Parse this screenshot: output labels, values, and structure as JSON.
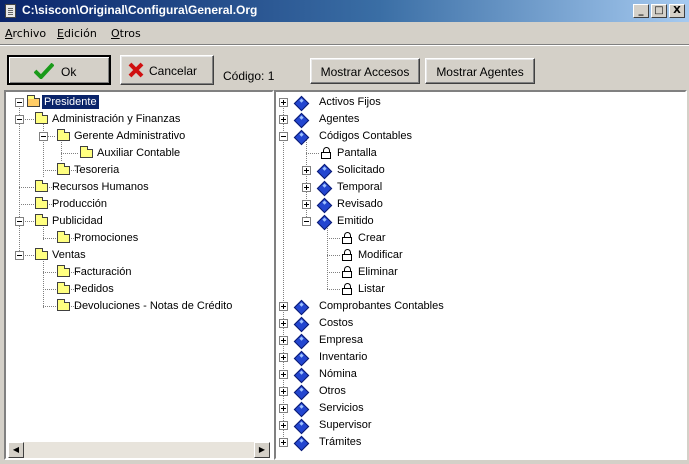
{
  "window": {
    "title": "C:\\siscon\\Original\\Configura\\General.Org",
    "min": "_",
    "max": "□",
    "close": "X"
  },
  "menu": [
    {
      "pre": "",
      "key": "A",
      "rest": "rchivo"
    },
    {
      "pre": "",
      "key": "E",
      "rest": "dición"
    },
    {
      "pre": "",
      "key": "O",
      "rest": "tros"
    }
  ],
  "toolbar": {
    "ok_label": "Ok",
    "cancel_label": "Cancelar",
    "codigo_label": "Código: 1",
    "accesos_label": "Mostrar Accesos",
    "agentes_label": "Mostrar Agentes"
  },
  "org_tree": [
    "Presidente",
    "Administración y Finanzas",
    "Gerente Administrativo",
    "Auxiliar Contable",
    "Tesoreria",
    "Recursos Humanos",
    "Producción",
    "Publicidad",
    "Promociones",
    "Ventas",
    "Facturación",
    "Pedidos",
    "Devoluciones - Notas de Crédito"
  ],
  "access_tree": [
    "Activos Fijos",
    "Agentes",
    "Códigos Contables",
    "Pantalla",
    "Solicitado",
    "Temporal",
    "Revisado",
    "Emitido",
    "Crear",
    "Modificar",
    "Eliminar",
    "Listar",
    "Comprobantes Contables",
    "Costos",
    "Empresa",
    "Inventario",
    "Nómina",
    "Otros",
    "Servicios",
    "Supervisor",
    "Trámites"
  ],
  "scroll": {
    "left_arrow": "◀",
    "right_arrow": "▶"
  },
  "colors": {
    "title_start": "#0a246a",
    "title_end": "#a6caf0",
    "selection": "#0a246a",
    "diamond": "#2346d0",
    "folder": "#ffff80"
  }
}
